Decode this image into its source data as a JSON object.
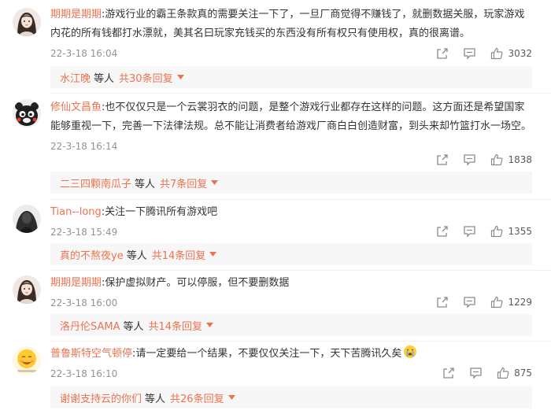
{
  "comments": [
    {
      "author": "期期是期期",
      "text": ":游戏行业的霸王条款真的需要关注一下了，一旦厂商觉得不赚钱了，就删数据关服，玩家游戏内花的所有钱都打水漂就，美其名曰玩家充钱买的东西没有所有权只有使用权，真的很离谱。",
      "time": "22-3-18 16:04",
      "likes": "3032",
      "reply_name": "水江晚",
      "reply_etc": "等人",
      "reply_count": "共30条回复"
    },
    {
      "author": "修仙文昌鱼",
      "text": ":也不仅仅只是一个云裳羽衣的问题，是整个游戏行业都存在这样的问题。这方面还是希望国家能够重视一下，完善一下法律法规。总不能让消费者给游戏厂商白白创造财富，到头来却竹篮打水一场空。",
      "time": "22-3-18 16:14",
      "likes": "1838",
      "reply_name": "二三四颗南瓜子",
      "reply_etc": "等人",
      "reply_count": "共7条回复"
    },
    {
      "author": "Tian--long",
      "text": ":关注一下腾讯所有游戏吧",
      "time": "22-3-18 15:49",
      "likes": "1355",
      "reply_name": "真的不熬夜ye",
      "reply_etc": "等人",
      "reply_count": "共14条回复"
    },
    {
      "author": "期期是期期",
      "text": ":保护虚拟财产。可以停服，但不要删数据",
      "time": "22-3-18 16:00",
      "likes": "1229",
      "reply_name": "洛丹伦SAMA",
      "reply_etc": "等人",
      "reply_count": "共14条回复"
    },
    {
      "author": "普鲁斯特空气顿停",
      "text": ":请一定要给一个结果，不要仅仅关注一下，天下苦腾讯久矣",
      "time": "22-3-18 16:10",
      "likes": "875",
      "reply_name": "谢谢支持云的你们",
      "reply_etc": "等人",
      "reply_count": "共26条回复"
    }
  ],
  "icons": {
    "share": "share-icon",
    "comment": "comment-icon",
    "like": "thumbs-up-icon",
    "caret": "caret-down-icon",
    "emoji": "crying-face-emoji"
  },
  "colors": {
    "accent": "#eb7350",
    "text": "#333333",
    "meta": "#939393",
    "reply_bg": "#f7f7f7"
  }
}
